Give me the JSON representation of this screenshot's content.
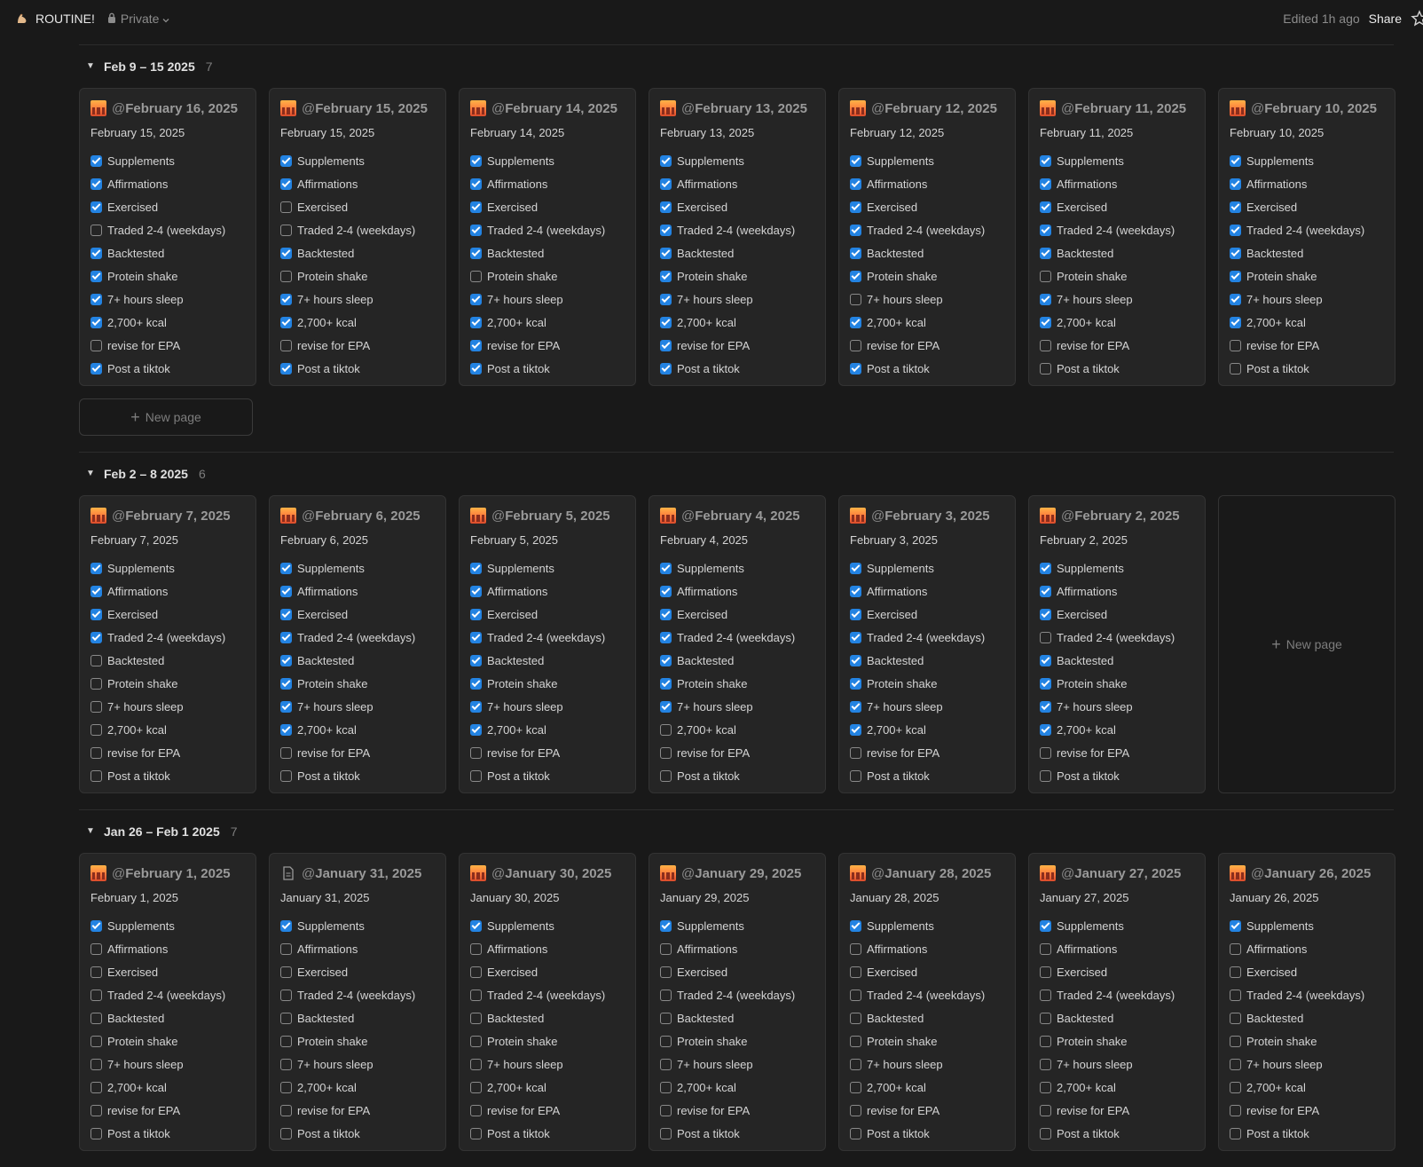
{
  "topbar": {
    "title": "ROUTINE!",
    "privacy": "Private",
    "edited": "Edited 1h ago",
    "share": "Share"
  },
  "icons": {
    "page": "flexed-biceps-icon",
    "lock": "lock-icon",
    "chevron": "chevron-down-icon",
    "star": "star-icon",
    "card_emoji": "city-sunset-icon",
    "card_doc": "document-icon",
    "plus": "plus-icon",
    "toggle": "triangle-down-icon"
  },
  "colors": {
    "checkbox_on": "#2383e2",
    "background": "#191919",
    "card": "#252525"
  },
  "new_page_label": "New page",
  "task_labels": [
    "Supplements",
    "Affirmations",
    "Exercised",
    "Traded 2-4 (weekdays)",
    "Backtested",
    "Protein shake",
    "7+ hours sleep",
    "2,700+ kcal",
    "revise for EPA",
    "Post a tiktok"
  ],
  "groups": [
    {
      "title": "Feb 9 – 15 2025",
      "count": "7",
      "cards": [
        {
          "mention": "February 16, 2025",
          "date": "February 15, 2025",
          "icon": "emoji",
          "checks": [
            1,
            1,
            1,
            0,
            1,
            1,
            1,
            1,
            0,
            1
          ]
        },
        {
          "mention": "February 15, 2025",
          "date": "February 15, 2025",
          "icon": "emoji",
          "checks": [
            1,
            1,
            0,
            0,
            1,
            0,
            1,
            1,
            0,
            1
          ]
        },
        {
          "mention": "February 14, 2025",
          "date": "February 14, 2025",
          "icon": "emoji",
          "checks": [
            1,
            1,
            1,
            1,
            1,
            0,
            1,
            1,
            1,
            1
          ]
        },
        {
          "mention": "February 13, 2025",
          "date": "February 13, 2025",
          "icon": "emoji",
          "checks": [
            1,
            1,
            1,
            1,
            1,
            1,
            1,
            1,
            1,
            1
          ]
        },
        {
          "mention": "February 12, 2025",
          "date": "February 12, 2025",
          "icon": "emoji",
          "checks": [
            1,
            1,
            1,
            1,
            1,
            1,
            0,
            1,
            0,
            1
          ]
        },
        {
          "mention": "February 11, 2025",
          "date": "February 11, 2025",
          "icon": "emoji",
          "checks": [
            1,
            1,
            1,
            1,
            1,
            0,
            1,
            1,
            0,
            0
          ]
        },
        {
          "mention": "February 10, 2025",
          "date": "February 10, 2025",
          "icon": "emoji",
          "checks": [
            1,
            1,
            1,
            1,
            1,
            1,
            1,
            1,
            0,
            0
          ]
        }
      ],
      "new_page_button": true
    },
    {
      "title": "Feb 2 – 8 2025",
      "count": "6",
      "cards": [
        {
          "mention": "February 7, 2025",
          "date": "February 7, 2025",
          "icon": "emoji",
          "checks": [
            1,
            1,
            1,
            1,
            0,
            0,
            0,
            0,
            0,
            0
          ]
        },
        {
          "mention": "February 6, 2025",
          "date": "February 6, 2025",
          "icon": "emoji",
          "checks": [
            1,
            1,
            1,
            1,
            1,
            1,
            1,
            1,
            0,
            0
          ]
        },
        {
          "mention": "February 5, 2025",
          "date": "February 5, 2025",
          "icon": "emoji",
          "checks": [
            1,
            1,
            1,
            1,
            1,
            1,
            1,
            1,
            0,
            0
          ]
        },
        {
          "mention": "February 4, 2025",
          "date": "February 4, 2025",
          "icon": "emoji",
          "checks": [
            1,
            1,
            1,
            1,
            1,
            1,
            1,
            0,
            0,
            0
          ]
        },
        {
          "mention": "February 3, 2025",
          "date": "February 3, 2025",
          "icon": "emoji",
          "checks": [
            1,
            1,
            1,
            1,
            1,
            1,
            1,
            1,
            0,
            0
          ]
        },
        {
          "mention": "February 2, 2025",
          "date": "February 2, 2025",
          "icon": "emoji",
          "checks": [
            1,
            1,
            1,
            0,
            1,
            1,
            1,
            1,
            0,
            0
          ]
        }
      ],
      "placeholder_new_page": true
    },
    {
      "title": "Jan 26 – Feb 1 2025",
      "count": "7",
      "cards": [
        {
          "mention": "February 1, 2025",
          "date": "February 1, 2025",
          "icon": "emoji",
          "checks": [
            1,
            0,
            0,
            0,
            0,
            0,
            0,
            0,
            0,
            0
          ]
        },
        {
          "mention": "January 31, 2025",
          "date": "January 31, 2025",
          "icon": "doc",
          "checks": [
            1,
            0,
            0,
            0,
            0,
            0,
            0,
            0,
            0,
            0
          ]
        },
        {
          "mention": "January 30, 2025",
          "date": "January 30, 2025",
          "icon": "emoji",
          "checks": [
            1,
            0,
            0,
            0,
            0,
            0,
            0,
            0,
            0,
            0
          ]
        },
        {
          "mention": "January 29, 2025",
          "date": "January 29, 2025",
          "icon": "emoji",
          "checks": [
            1,
            0,
            0,
            0,
            0,
            0,
            0,
            0,
            0,
            0
          ]
        },
        {
          "mention": "January 28, 2025",
          "date": "January 28, 2025",
          "icon": "emoji",
          "checks": [
            1,
            0,
            0,
            0,
            0,
            0,
            0,
            0,
            0,
            0
          ]
        },
        {
          "mention": "January 27, 2025",
          "date": "January 27, 2025",
          "icon": "emoji",
          "checks": [
            1,
            0,
            0,
            0,
            0,
            0,
            0,
            0,
            0,
            0
          ]
        },
        {
          "mention": "January 26, 2025",
          "date": "January 26, 2025",
          "icon": "emoji",
          "checks": [
            1,
            0,
            0,
            0,
            0,
            0,
            0,
            0,
            0,
            0
          ]
        }
      ]
    }
  ]
}
